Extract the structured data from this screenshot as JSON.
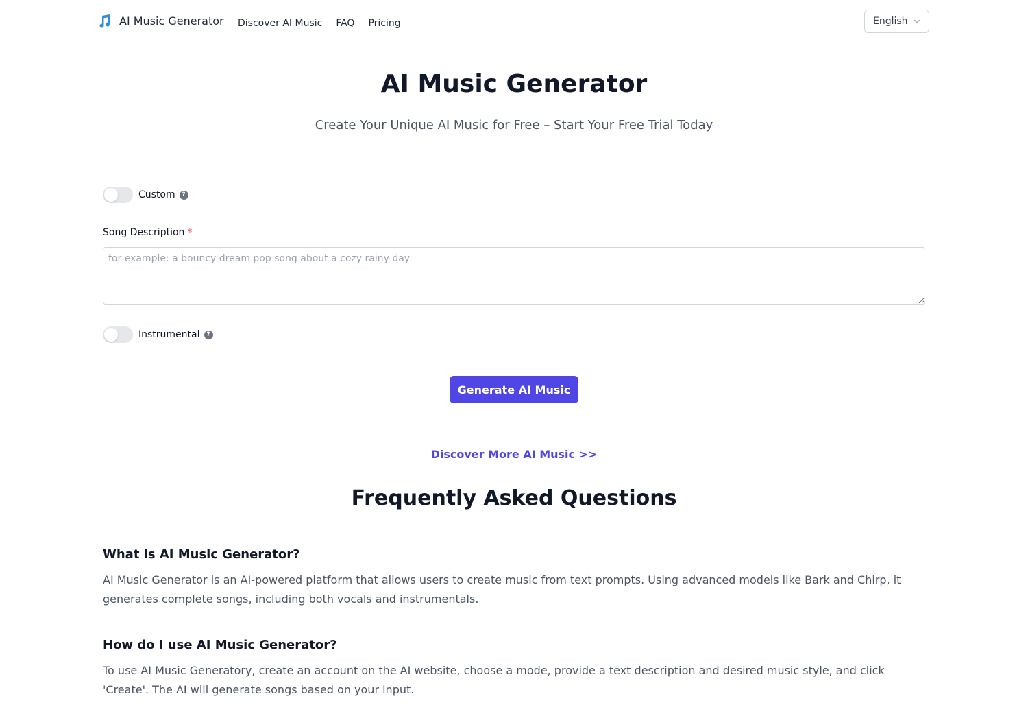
{
  "header": {
    "logo_icon": "music-note-icon",
    "logo_text": "AI Music Generator",
    "nav": [
      {
        "label": "Discover AI Music"
      },
      {
        "label": "FAQ"
      },
      {
        "label": "Pricing"
      }
    ],
    "language": {
      "selected": "English",
      "icon": "chevron-down-icon"
    }
  },
  "hero": {
    "title": "AI Music Generator",
    "subtitle": "Create Your Unique AI Music for Free – Start Your Free Trial Today"
  },
  "form": {
    "custom_toggle": {
      "label": "Custom",
      "on": false,
      "help_icon": "question-circle-icon"
    },
    "song_description": {
      "label": "Song Description",
      "required_mark": "*",
      "value": "",
      "placeholder": "for example: a bouncy dream pop song about a cozy rainy day"
    },
    "instrumental_toggle": {
      "label": "Instrumental",
      "on": false,
      "help_icon": "question-circle-icon"
    },
    "help_glyph": "?",
    "generate_label": "Generate AI Music"
  },
  "discover_more_label": "Discover More AI Music >>",
  "faq": {
    "title": "Frequently Asked Questions",
    "items": [
      {
        "question": "What is AI Music Generator?",
        "answer": "AI Music Generator is an AI-powered platform that allows users to create music from text prompts. Using advanced models like Bark and Chirp, it generates complete songs, including both vocals and instrumentals."
      },
      {
        "question": "How do I use AI Music Generator?",
        "answer": "To use AI Music Generatory, create an account on the AI website, choose a mode, provide a text description and desired music style, and click 'Create'. The AI will generate songs based on your input."
      }
    ]
  },
  "colors": {
    "brand": "#4f46e5",
    "logo_icon": "#2f8fd8",
    "required": "#ef4444"
  }
}
